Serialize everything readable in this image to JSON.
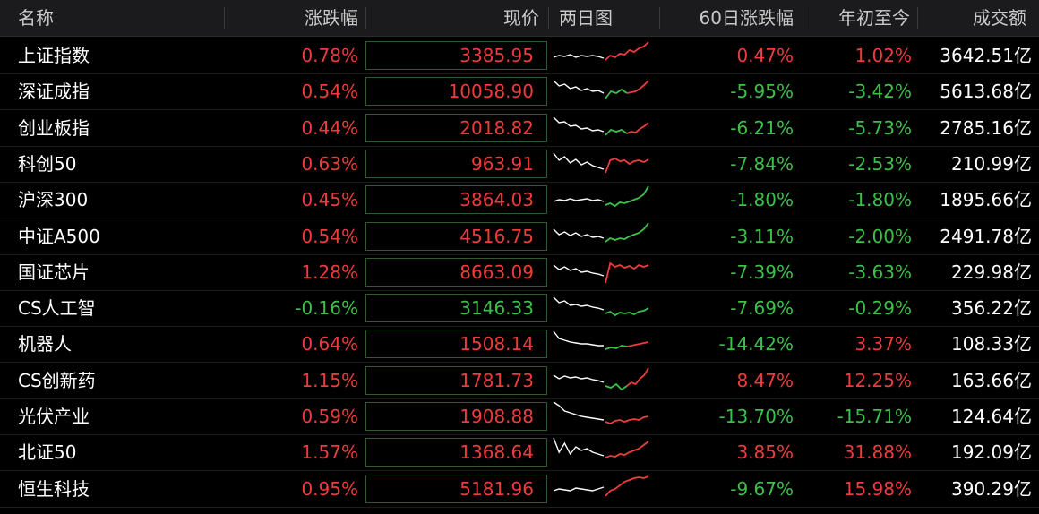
{
  "header": {
    "name": "名称",
    "change": "涨跌幅",
    "price": "现价",
    "two_day": "两日图",
    "change60": "60日涨跌幅",
    "ytd": "年初至今",
    "turnover": "成交额"
  },
  "colors": {
    "up": "#ee3b3b",
    "down": "#3cc04a",
    "neutral": "#ffffff",
    "header_bg": "#1b1b1d"
  },
  "rows": [
    {
      "name": "上证指数",
      "change": "0.78%",
      "price": "3385.95",
      "change60": "0.47%",
      "ytd": "1.02%",
      "turnover": "3642.51亿",
      "c_dir": "up",
      "p_dir": "up",
      "s60_dir": "up",
      "ytd_dir": "up",
      "day2_dir": "up",
      "spark": "up1"
    },
    {
      "name": "深证成指",
      "change": "0.54%",
      "price": "10058.90",
      "change60": "-5.95%",
      "ytd": "-3.42%",
      "turnover": "5613.68亿",
      "c_dir": "up",
      "p_dir": "up",
      "s60_dir": "down",
      "ytd_dir": "down",
      "day2_dir": "mix",
      "spark": "mix1"
    },
    {
      "name": "创业板指",
      "change": "0.44%",
      "price": "2018.82",
      "change60": "-6.21%",
      "ytd": "-5.73%",
      "turnover": "2785.16亿",
      "c_dir": "up",
      "p_dir": "up",
      "s60_dir": "down",
      "ytd_dir": "down",
      "day2_dir": "mix",
      "spark": "mix2"
    },
    {
      "name": "科创50",
      "change": "0.63%",
      "price": "963.91",
      "change60": "-7.84%",
      "ytd": "-2.53%",
      "turnover": "210.99亿",
      "c_dir": "up",
      "p_dir": "up",
      "s60_dir": "down",
      "ytd_dir": "down",
      "day2_dir": "up",
      "spark": "up2"
    },
    {
      "name": "沪深300",
      "change": "0.45%",
      "price": "3864.03",
      "change60": "-1.80%",
      "ytd": "-1.80%",
      "turnover": "1895.66亿",
      "c_dir": "up",
      "p_dir": "up",
      "s60_dir": "down",
      "ytd_dir": "down",
      "day2_dir": "down",
      "spark": "down1"
    },
    {
      "name": "中证A500",
      "change": "0.54%",
      "price": "4516.75",
      "change60": "-3.11%",
      "ytd": "-2.00%",
      "turnover": "2491.78亿",
      "c_dir": "up",
      "p_dir": "up",
      "s60_dir": "down",
      "ytd_dir": "down",
      "day2_dir": "down",
      "spark": "down2"
    },
    {
      "name": "国证芯片",
      "change": "1.28%",
      "price": "8663.09",
      "change60": "-7.39%",
      "ytd": "-3.63%",
      "turnover": "229.98亿",
      "c_dir": "up",
      "p_dir": "up",
      "s60_dir": "down",
      "ytd_dir": "down",
      "day2_dir": "up",
      "spark": "up3"
    },
    {
      "name": "CS人工智",
      "change": "-0.16%",
      "price": "3146.33",
      "change60": "-7.69%",
      "ytd": "-0.29%",
      "turnover": "356.22亿",
      "c_dir": "down",
      "p_dir": "down",
      "s60_dir": "down",
      "ytd_dir": "down",
      "day2_dir": "down",
      "spark": "down3"
    },
    {
      "name": "机器人",
      "change": "0.64%",
      "price": "1508.14",
      "change60": "-14.42%",
      "ytd": "3.37%",
      "turnover": "108.33亿",
      "c_dir": "up",
      "p_dir": "up",
      "s60_dir": "down",
      "ytd_dir": "up",
      "day2_dir": "mix",
      "spark": "mix3"
    },
    {
      "name": "CS创新药",
      "change": "1.15%",
      "price": "1781.73",
      "change60": "8.47%",
      "ytd": "12.25%",
      "turnover": "163.66亿",
      "c_dir": "up",
      "p_dir": "up",
      "s60_dir": "up",
      "ytd_dir": "up",
      "day2_dir": "mix",
      "spark": "mix4"
    },
    {
      "name": "光伏产业",
      "change": "0.59%",
      "price": "1908.88",
      "change60": "-13.70%",
      "ytd": "-15.71%",
      "turnover": "124.64亿",
      "c_dir": "up",
      "p_dir": "up",
      "s60_dir": "down",
      "ytd_dir": "down",
      "day2_dir": "up",
      "spark": "up4"
    },
    {
      "name": "北证50",
      "change": "1.57%",
      "price": "1368.64",
      "change60": "3.85%",
      "ytd": "31.88%",
      "turnover": "192.09亿",
      "c_dir": "up",
      "p_dir": "up",
      "s60_dir": "up",
      "ytd_dir": "up",
      "day2_dir": "up",
      "spark": "up5"
    },
    {
      "name": "恒生科技",
      "change": "0.95%",
      "price": "5181.96",
      "change60": "-9.67%",
      "ytd": "15.98%",
      "turnover": "390.29亿",
      "c_dir": "up",
      "p_dir": "up",
      "s60_dir": "down",
      "ytd_dir": "up",
      "day2_dir": "up",
      "spark": "up6"
    }
  ]
}
